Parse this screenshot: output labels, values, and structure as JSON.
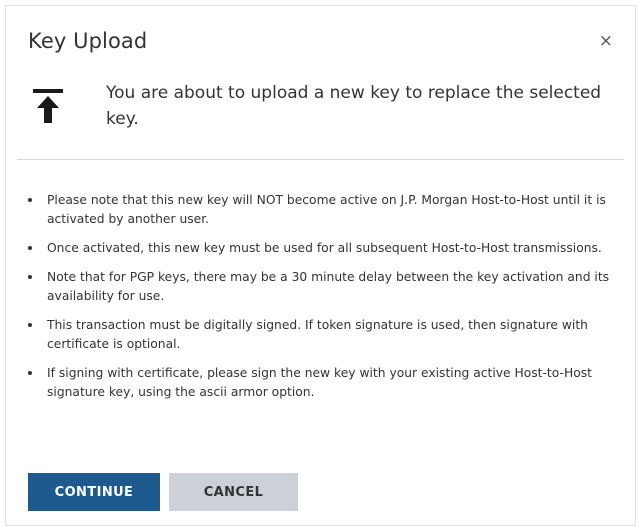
{
  "dialog": {
    "title": "Key Upload",
    "close_label": "×",
    "intro": "You are about to upload a new key to replace the selected key.",
    "notes": [
      "Please note that this new key will NOT become active on J.P. Morgan Host-to-Host until it is activated by another user.",
      "Once activated, this new key must be used for all subsequent Host-to-Host transmissions.",
      "Note that for PGP keys, there may be a 30 minute delay between the key activation and its availability for use.",
      "This transaction must be digitally signed. If token signature is used, then signature with certificate is optional.",
      "If signing with certificate, please sign the new key with your existing active Host-to-Host signature key, using the ascii armor option."
    ],
    "buttons": {
      "continue_label": "CONTINUE",
      "cancel_label": "CANCEL"
    },
    "icon": "upload-icon"
  },
  "colors": {
    "primary": "#1f5a8e",
    "secondary": "#cbd1d6",
    "text": "#333333"
  }
}
